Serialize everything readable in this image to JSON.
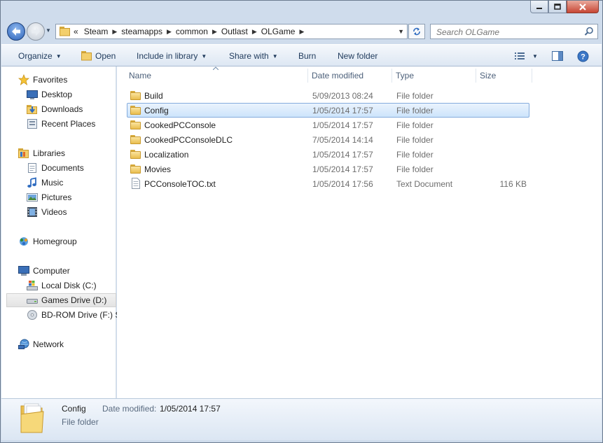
{
  "window": {
    "controls": {
      "minimize": "minimize-icon",
      "maximize": "maximize-icon",
      "close": "close-icon"
    }
  },
  "nav": {
    "back_icon": "back-arrow-icon",
    "forward_icon": "forward-arrow-icon",
    "overflow": "«"
  },
  "address": {
    "segments": [
      "Steam",
      "steamapps",
      "common",
      "Outlast",
      "OLGame"
    ]
  },
  "search": {
    "placeholder": "Search OLGame"
  },
  "toolbar": {
    "organize": "Organize",
    "open": "Open",
    "include_in_library": "Include in library",
    "share_with": "Share with",
    "burn": "Burn",
    "new_folder": "New folder"
  },
  "sidebar": {
    "favorites": {
      "label": "Favorites",
      "items": [
        "Desktop",
        "Downloads",
        "Recent Places"
      ]
    },
    "libraries": {
      "label": "Libraries",
      "items": [
        "Documents",
        "Music",
        "Pictures",
        "Videos"
      ]
    },
    "homegroup": "Homegroup",
    "computer": {
      "label": "Computer",
      "items": [
        "Local Disk (C:)",
        "Games Drive (D:)",
        "BD-ROM Drive (F:) S"
      ],
      "selected": "Games Drive (D:)"
    },
    "network": "Network"
  },
  "columns": {
    "name": "Name",
    "date": "Date modified",
    "type": "Type",
    "size": "Size"
  },
  "files": [
    {
      "name": "Build",
      "date": "5/09/2013 08:24",
      "type": "File folder",
      "size": "",
      "kind": "folder"
    },
    {
      "name": "Config",
      "date": "1/05/2014 17:57",
      "type": "File folder",
      "size": "",
      "kind": "folder",
      "selected": true
    },
    {
      "name": "CookedPCConsole",
      "date": "1/05/2014 17:57",
      "type": "File folder",
      "size": "",
      "kind": "folder"
    },
    {
      "name": "CookedPCConsoleDLC",
      "date": "7/05/2014 14:14",
      "type": "File folder",
      "size": "",
      "kind": "folder"
    },
    {
      "name": "Localization",
      "date": "1/05/2014 17:57",
      "type": "File folder",
      "size": "",
      "kind": "folder"
    },
    {
      "name": "Movies",
      "date": "1/05/2014 17:57",
      "type": "File folder",
      "size": "",
      "kind": "folder"
    },
    {
      "name": "PCConsoleTOC.txt",
      "date": "1/05/2014 17:56",
      "type": "Text Document",
      "size": "116 KB",
      "kind": "text"
    }
  ],
  "details": {
    "name": "Config",
    "date_label": "Date modified:",
    "date_value": "1/05/2014 17:57",
    "type": "File folder"
  }
}
